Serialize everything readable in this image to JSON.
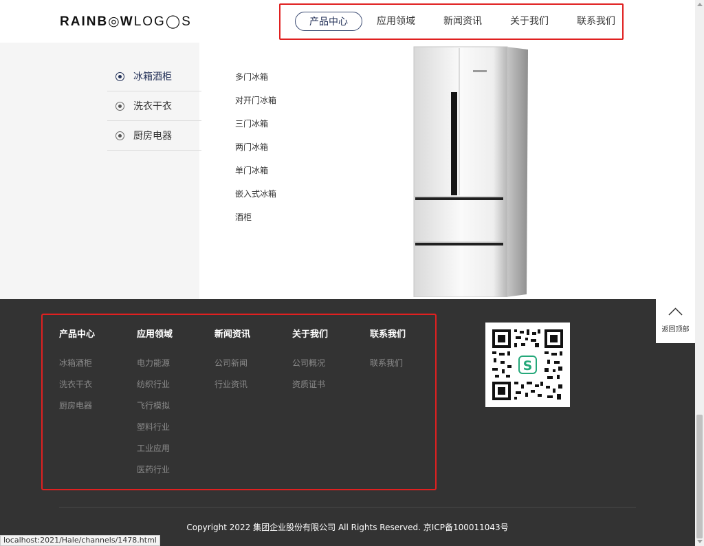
{
  "header": {
    "logo": "RAINBOWLOGOS",
    "nav": [
      {
        "label": "产品中心",
        "active": true
      },
      {
        "label": "应用领域",
        "active": false
      },
      {
        "label": "新闻资讯",
        "active": false
      },
      {
        "label": "关于我们",
        "active": false
      },
      {
        "label": "联系我们",
        "active": false
      }
    ]
  },
  "sidebar": {
    "categories": [
      {
        "label": "冰箱酒柜",
        "active": true
      },
      {
        "label": "洗衣干衣",
        "active": false
      },
      {
        "label": "厨房电器",
        "active": false
      }
    ]
  },
  "subcategories": [
    "多门冰箱",
    "对开门冰箱",
    "三门冰箱",
    "两门冰箱",
    "单门冰箱",
    "嵌入式冰箱",
    "酒柜"
  ],
  "footer": {
    "columns": [
      {
        "title": "产品中心",
        "links": [
          "冰箱酒柜",
          "洗衣干衣",
          "厨房电器"
        ]
      },
      {
        "title": "应用领域",
        "links": [
          "电力能源",
          "纺织行业",
          "飞行模拟",
          "塑料行业",
          "工业应用",
          "医药行业"
        ]
      },
      {
        "title": "新闻资讯",
        "links": [
          "公司新闻",
          "行业资讯"
        ]
      },
      {
        "title": "关于我们",
        "links": [
          "公司概况",
          "资质证书"
        ]
      },
      {
        "title": "联系我们",
        "links": [
          "联系我们"
        ]
      }
    ],
    "copyright": "Copyright 2022 集团企业股份有限公司 All Rights Reserved. 京ICP备100011043号"
  },
  "back_to_top": {
    "label": "返回顶部",
    "icon": "chevron-up-icon"
  },
  "status_bar": {
    "url": "localhost:2021/Hale/channels/1478.html"
  },
  "colors": {
    "accent": "#1f2d55",
    "highlight_border": "#e02020",
    "footer_bg": "#333333"
  }
}
